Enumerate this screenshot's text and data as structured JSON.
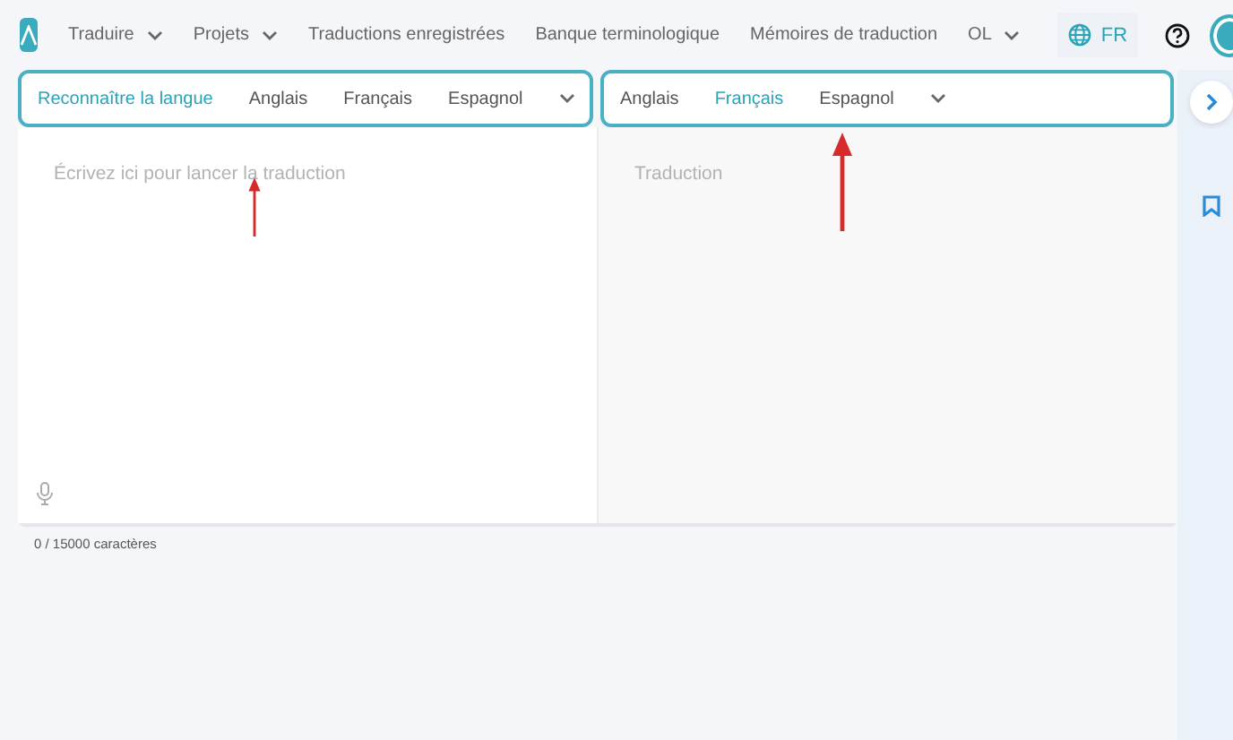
{
  "nav": {
    "items": [
      {
        "label": "Traduire",
        "dropdown": true
      },
      {
        "label": "Projets",
        "dropdown": true
      },
      {
        "label": "Traductions enregistrées",
        "dropdown": false
      },
      {
        "label": "Banque terminologique",
        "dropdown": false
      },
      {
        "label": "Mémoires de traduction",
        "dropdown": false
      },
      {
        "label": "OL",
        "dropdown": true
      }
    ],
    "language_button": "FR"
  },
  "source": {
    "languages": [
      {
        "label": "Reconnaître la langue",
        "selected": true
      },
      {
        "label": "Anglais",
        "selected": false
      },
      {
        "label": "Français",
        "selected": false
      },
      {
        "label": "Espagnol",
        "selected": false
      }
    ],
    "placeholder": "Écrivez ici pour lancer la traduction",
    "counter": "0 / 15000 caractères"
  },
  "target": {
    "languages": [
      {
        "label": "Anglais",
        "selected": false
      },
      {
        "label": "Français",
        "selected": true
      },
      {
        "label": "Espagnol",
        "selected": false
      }
    ],
    "placeholder": "Traduction"
  },
  "annotations": [
    {
      "kind": "arrow"
    },
    {
      "kind": "arrow"
    }
  ]
}
